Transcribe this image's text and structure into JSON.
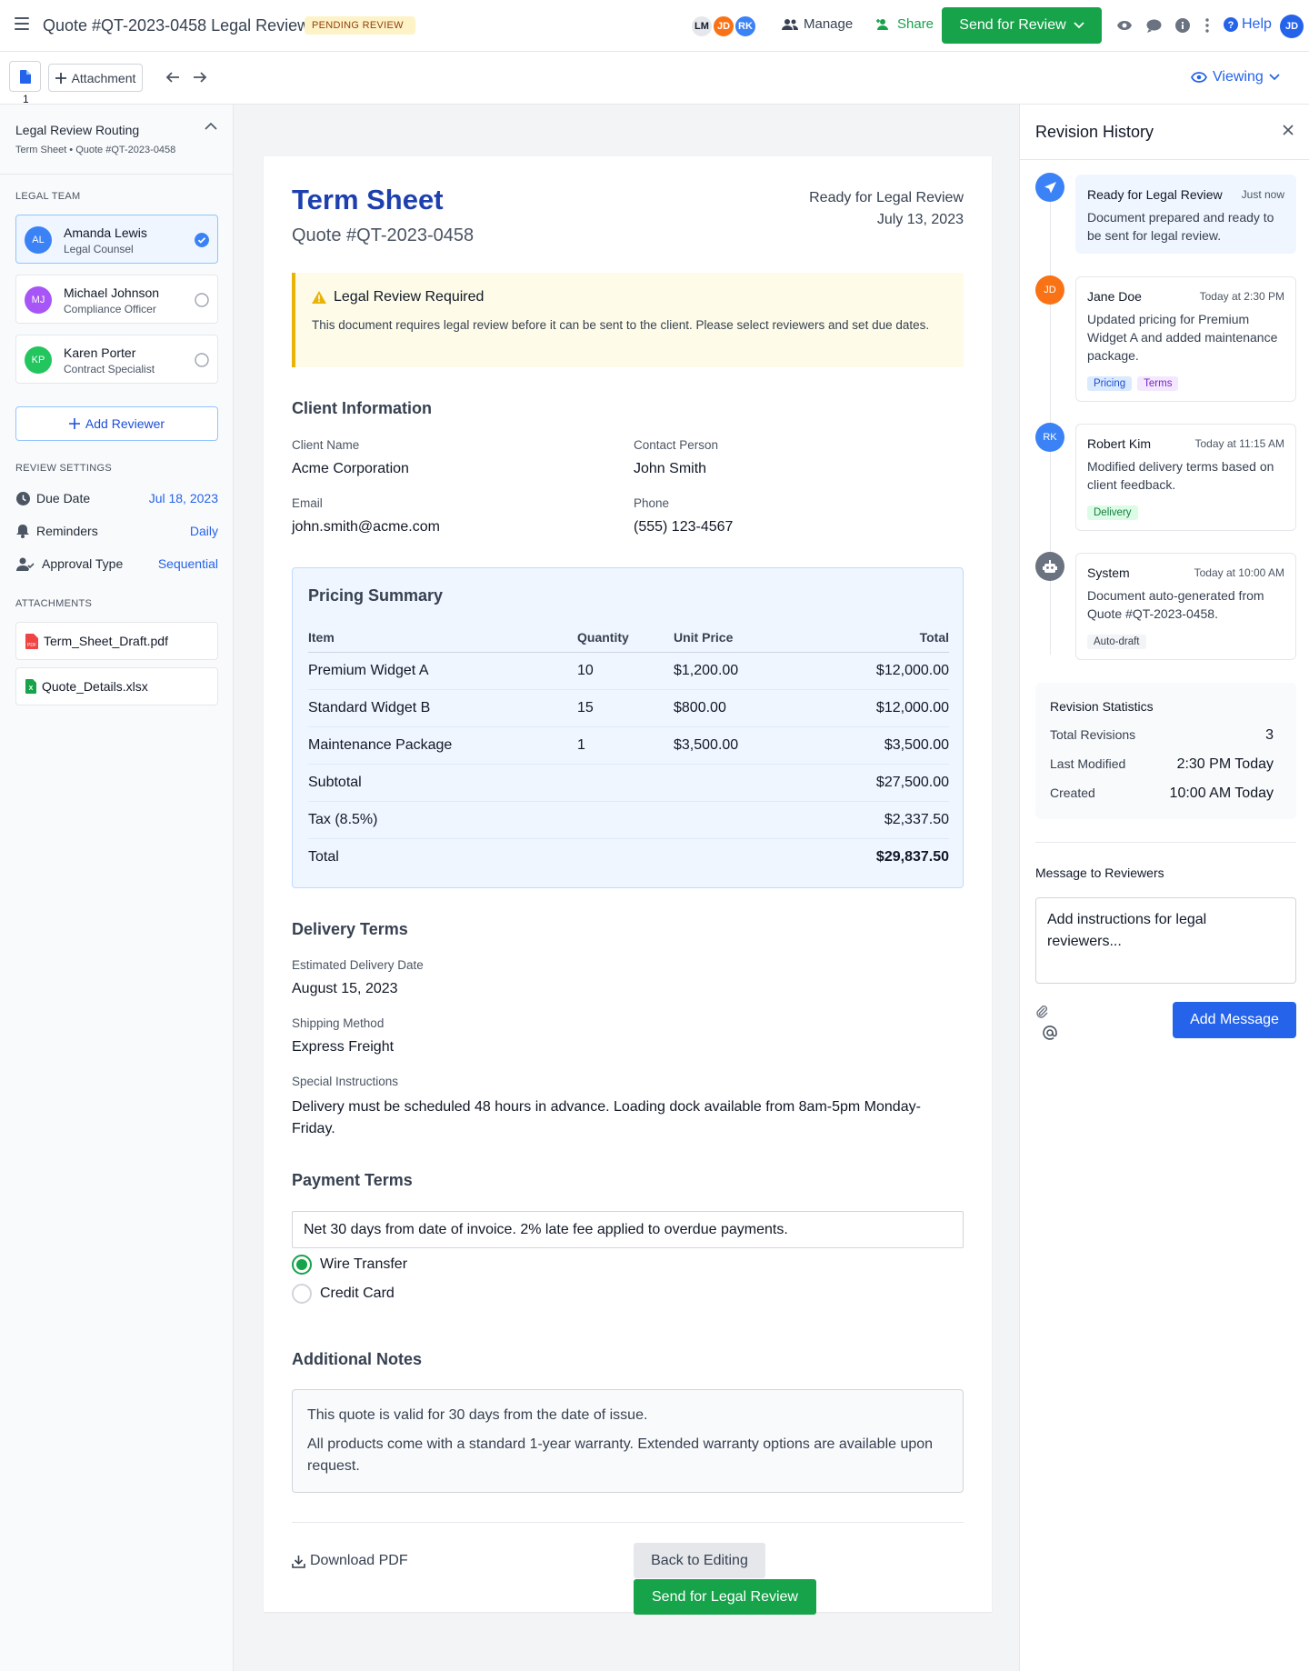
{
  "header": {
    "title": "Quote #QT-2023-0458 Legal Review",
    "status_badge": "PENDING REVIEW",
    "avatars": [
      {
        "initials": "LM",
        "bg": "#e5e7eb",
        "fg": "#111827"
      },
      {
        "initials": "JD",
        "bg": "#f97316",
        "fg": "#ffffff"
      },
      {
        "initials": "RK",
        "bg": "#3b82f6",
        "fg": "#ffffff"
      }
    ],
    "manage_label": "Manage",
    "share_label": "Share",
    "send_review_label": "Send for Review",
    "help_label": "Help",
    "user_initials": "JD"
  },
  "toolbar": {
    "page_number": "1",
    "attachment_label": "Attachment",
    "viewing_label": "Viewing"
  },
  "sidebar": {
    "title": "Legal Review Routing",
    "subtitle": "Term Sheet • Quote #QT-2023-0458",
    "legal_team_label": "LEGAL TEAM",
    "reviewers": [
      {
        "initials": "AL",
        "name": "Amanda Lewis",
        "role": "Legal Counsel",
        "color": "#3b82f6",
        "selected": true
      },
      {
        "initials": "MJ",
        "name": "Michael Johnson",
        "role": "Compliance Officer",
        "color": "#a855f7",
        "selected": false
      },
      {
        "initials": "KP",
        "name": "Karen Porter",
        "role": "Contract Specialist",
        "color": "#22c55e",
        "selected": false
      }
    ],
    "add_reviewer_label": "Add Reviewer",
    "review_settings_label": "REVIEW SETTINGS",
    "settings": [
      {
        "label": "Due Date",
        "value": "Jul 18, 2023",
        "icon": "clock-icon"
      },
      {
        "label": "Reminders",
        "value": "Daily",
        "icon": "bell-icon"
      },
      {
        "label": "Approval Type",
        "value": "Sequential",
        "icon": "user-check-icon"
      }
    ],
    "attachments_label": "ATTACHMENTS",
    "attachments": [
      {
        "name": "Term_Sheet_Draft.pdf",
        "icon": "pdf-file-icon"
      },
      {
        "name": "Quote_Details.xlsx",
        "icon": "excel-file-icon"
      }
    ]
  },
  "document": {
    "title": "Term Sheet",
    "quote_number": "Quote #QT-2023-0458",
    "status_line1": "Ready for Legal Review",
    "status_line2": "July 13, 2023",
    "alert_title": "Legal Review Required",
    "alert_text": "This document requires legal review before it can be sent to the client. Please select reviewers and set due dates.",
    "client_section": "Client Information",
    "client_fields": [
      {
        "label": "Client Name",
        "value": "Acme Corporation"
      },
      {
        "label": "Contact Person",
        "value": "John Smith"
      },
      {
        "label": "Email",
        "value": "john.smith@acme.com"
      },
      {
        "label": "Phone",
        "value": "(555) 123-4567"
      }
    ],
    "pricing": {
      "title": "Pricing Summary",
      "headers": [
        "Item",
        "Quantity",
        "Unit Price",
        "Total"
      ],
      "rows": [
        {
          "item": "Premium Widget A",
          "qty": "10",
          "unit": "$1,200.00",
          "total": "$12,000.00"
        },
        {
          "item": "Standard Widget B",
          "qty": "15",
          "unit": "$800.00",
          "total": "$12,000.00"
        },
        {
          "item": "Maintenance Package",
          "qty": "1",
          "unit": "$3,500.00",
          "total": "$3,500.00"
        }
      ],
      "subtotal_label": "Subtotal",
      "subtotal": "$27,500.00",
      "tax_label": "Tax (8.5%)",
      "tax": "$2,337.50",
      "total_label": "Total",
      "total": "$29,837.50"
    },
    "delivery_section": "Delivery Terms",
    "delivery": [
      {
        "label": "Estimated Delivery Date",
        "value": "August 15, 2023"
      },
      {
        "label": "Shipping Method",
        "value": "Express Freight"
      },
      {
        "label": "Special Instructions",
        "value": "Delivery must be scheduled 48 hours in advance. Loading dock available from 8am-5pm Monday-Friday."
      }
    ],
    "payment_section": "Payment Terms",
    "payment_terms_value": "Net 30 days from date of invoice. 2% late fee applied to overdue payments.",
    "payment_methods": [
      {
        "label": "Wire Transfer",
        "selected": true
      },
      {
        "label": "Credit Card",
        "selected": false
      }
    ],
    "notes_section": "Additional Notes",
    "notes": [
      "This quote is valid for 30 days from the date of issue.",
      "All products come with a standard 1-year warranty. Extended warranty options are available upon request."
    ],
    "download_label": "Download PDF",
    "back_label": "Back to Editing",
    "send_legal_label": "Send for Legal Review"
  },
  "revision_panel": {
    "title": "Revision History",
    "entries": [
      {
        "name": "Ready for Legal Review",
        "time": "Just now",
        "text": "Document prepared and ready to be sent for legal review.",
        "dot": "send-icon",
        "dot_color": "#3b82f6",
        "tags": []
      },
      {
        "name": "Jane Doe",
        "time": "Today at 2:30 PM",
        "text": "Updated pricing for Premium Widget A and added maintenance package.",
        "dot": "JD",
        "dot_color": "#f97316",
        "tags": [
          {
            "label": "Pricing",
            "bg": "#dbeafe",
            "fg": "#1d4ed8"
          },
          {
            "label": "Terms",
            "bg": "#f3e8ff",
            "fg": "#7e22ce"
          }
        ]
      },
      {
        "name": "Robert Kim",
        "time": "Today at 11:15 AM",
        "text": "Modified delivery terms based on client feedback.",
        "dot": "RK",
        "dot_color": "#3b82f6",
        "tags": [
          {
            "label": "Delivery",
            "bg": "#dcfce7",
            "fg": "#15803d"
          }
        ]
      },
      {
        "name": "System",
        "time": "Today at 10:00 AM",
        "text": "Document auto-generated from Quote #QT-2023-0458.",
        "dot": "robot-icon",
        "dot_color": "#6b7280",
        "tags": [
          {
            "label": "Auto-draft",
            "bg": "#f3f4f6",
            "fg": "#374151"
          }
        ]
      }
    ],
    "stats_title": "Revision Statistics",
    "stats": [
      {
        "label": "Total Revisions",
        "value": "3"
      },
      {
        "label": "Last Modified",
        "value": "2:30 PM Today"
      },
      {
        "label": "Created",
        "value": "10:00 AM Today"
      }
    ],
    "message_label": "Message to Reviewers",
    "message_placeholder": "Add instructions for legal reviewers...",
    "add_message_label": "Add Message"
  }
}
